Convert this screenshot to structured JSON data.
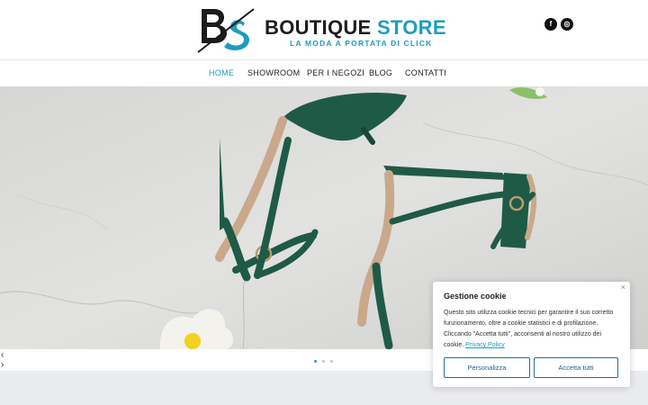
{
  "brand": {
    "title_part1": "BOUTIQUE",
    "title_part2": "STORE",
    "tagline": "LA MODA A PORTATA DI CLICK",
    "accent_color": "#1e9cc0"
  },
  "social": {
    "facebook_glyph": "f",
    "instagram_glyph": "◎"
  },
  "nav": {
    "items": [
      "HOME",
      "SHOWROOM",
      "PER I NEGOZI",
      "BLOG",
      "CONTATTI"
    ],
    "active": "HOME"
  },
  "slider": {
    "prev_glyph": "‹",
    "next_glyph": "›",
    "slides": 3,
    "active_slide": 1
  },
  "cookie": {
    "close_glyph": "×",
    "title": "Gestione cookie",
    "text": "Questo sito utilizza cookie tecnici per garantire il  suo corretto funzionamento,  oltre a cookie statistici e di profilazione. Cliccando \"Accetta tutti\", acconsenti al nostro utilizzo dei cookie.",
    "link": "Privacy Policy",
    "customize_label": "Personalizza",
    "accept_label": "Accetta tutti"
  }
}
